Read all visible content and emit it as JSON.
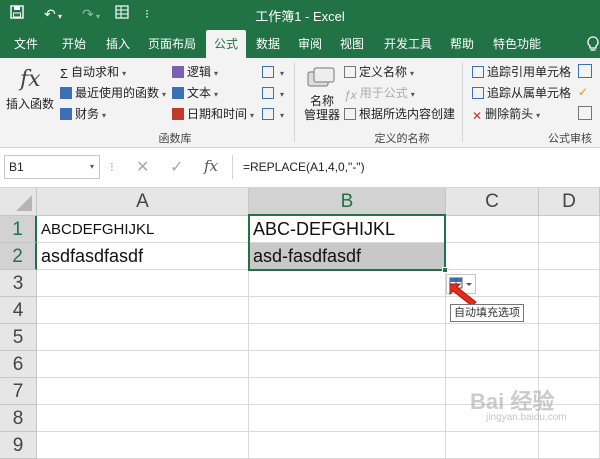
{
  "window": {
    "title": "工作簿1 - Excel",
    "accent": "#217346"
  },
  "tabs": [
    "文件",
    "开始",
    "插入",
    "页面布局",
    "公式",
    "数据",
    "审阅",
    "视图",
    "开发工具",
    "帮助",
    "特色功能"
  ],
  "active_tab": "公式",
  "ribbon": {
    "insert_function": "插入函数",
    "library": {
      "autosum": "自动求和",
      "recent": "最近使用的函数",
      "financial": "财务",
      "logical": "逻辑",
      "text": "文本",
      "datetime": "日期和时间",
      "group_label": "函数库"
    },
    "names": {
      "name_manager": "名称\n管理器",
      "define_name": "定义名称",
      "use_in_formula": "用于公式",
      "create_from_selection": "根据所选内容创建",
      "group_label": "定义的名称"
    },
    "audit": {
      "trace_precedents": "追踪引用单元格",
      "trace_dependents": "追踪从属单元格",
      "remove_arrows": "删除箭头",
      "group_label": "公式审核"
    }
  },
  "formula_bar": {
    "name_box": "B1",
    "formula": "=REPLACE(A1,4,0,\"-\")",
    "fx_label": "fx"
  },
  "grid": {
    "columns": [
      "A",
      "B",
      "C",
      "D"
    ],
    "rows": [
      "1",
      "2",
      "3",
      "4",
      "5",
      "6",
      "7",
      "8",
      "9"
    ],
    "cells": {
      "A1": "ABCDEFGHIJKL",
      "A2": "asdfasdfasdf",
      "B1": "ABC-DEFGHIJKL",
      "B2": "asd-fasdfasdf"
    }
  },
  "autofill_tooltip": "自动填充选项",
  "watermark": {
    "text": "Bai 经验",
    "url": "jingyan.baidu.com"
  }
}
